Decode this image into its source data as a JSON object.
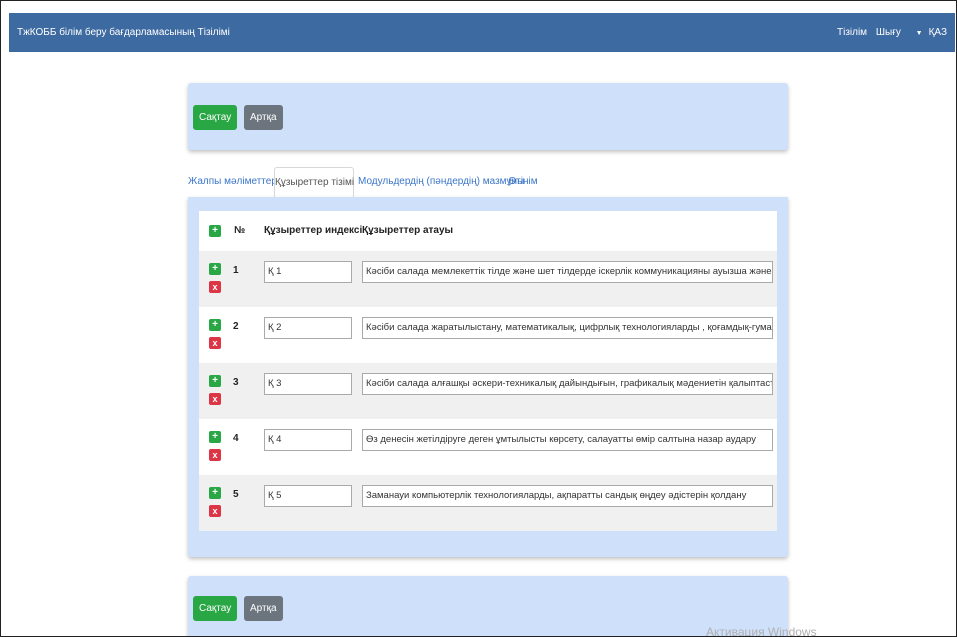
{
  "navbar": {
    "brand": "ТжКОББ білім беру бағдарламасының Тізілімі",
    "links": [
      "Тізілім",
      "Шығу"
    ],
    "language_caret": "▼",
    "language": "ҚАЗ"
  },
  "actions": {
    "save_label": "Сақтау",
    "back_label": "Артқа"
  },
  "tabs": [
    {
      "label": "Жалпы мәліметтер",
      "active": false
    },
    {
      "label": "Құзыреттер тізімі",
      "active": true
    },
    {
      "label": "Модульдердің (пәндердің) мазмұны",
      "active": false
    },
    {
      "label": "Өтінім",
      "active": false
    }
  ],
  "table": {
    "headers": {
      "no": "№",
      "index": "Құзыреттер индексі",
      "name": "Құзыреттер атауы"
    },
    "add_icon": "+",
    "remove_icon": "x",
    "rows": [
      {
        "no": "1",
        "index": "Қ 1",
        "name": "Кәсіби салада мемлекеттік тілде және шет тілдерде іскерлік коммуникацияны ауызша және жазбаша нысанда"
      },
      {
        "no": "2",
        "index": "Қ 2",
        "name": "Кәсіби салада жаратылыстану, математикалық, цифрлық технологияларды , қоғамдық-гуманитарлық білімдер"
      },
      {
        "no": "3",
        "index": "Қ 3",
        "name": "Кәсіби салада алғашқы әскери-техникалық дайындығын, графикалық мәдениетін қалыптастыру"
      },
      {
        "no": "4",
        "index": "Қ 4",
        "name": "Өз денесін жетілдіруге деген ұмтылысты көрсету, салауатты өмір салтына назар аудару"
      },
      {
        "no": "5",
        "index": "Қ 5",
        "name": "Заманауи компьютерлік технологияларды, ақпаратты сандық өңдеу әдістерін қолдану"
      }
    ]
  },
  "watermark": "Активация Windows",
  "colors": {
    "navbar": "#3d6aa1",
    "card_background": "#cfe0fb",
    "save_button": "#29a745",
    "back_button": "#6c757d",
    "add_icon": "#29a745",
    "remove_icon": "#dc3545",
    "tab_link": "#3b76c9"
  }
}
